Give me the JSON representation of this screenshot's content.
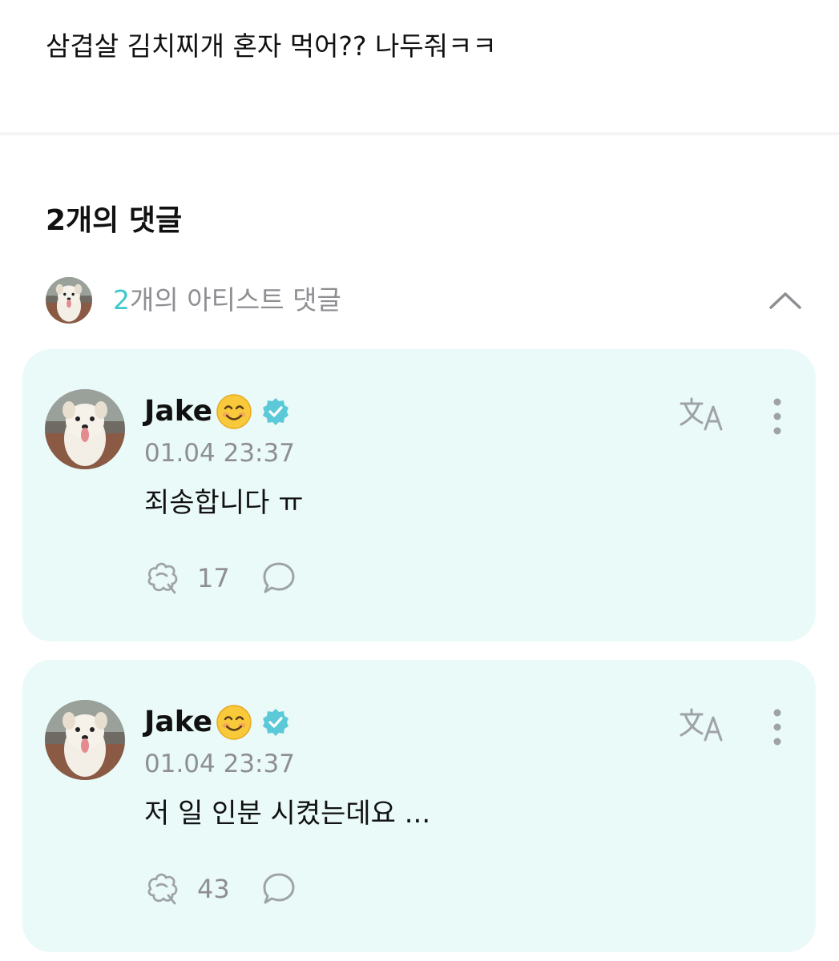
{
  "post": {
    "text": "삼겹살 김치찌개 혼자 먹어?? 나두줘ㅋㅋ"
  },
  "comments_section": {
    "title": "2개의 댓글",
    "artist_toggle": {
      "count": "2",
      "label": "개의 아티스트 댓글",
      "expanded": true
    }
  },
  "comments": [
    {
      "author": "Jake",
      "author_emoji": "smiling-face-icon",
      "verified": true,
      "timestamp": "01.04 23:37",
      "text": "죄송합니다 ㅠ",
      "likes": "17"
    },
    {
      "author": "Jake",
      "author_emoji": "smiling-face-icon",
      "verified": true,
      "timestamp": "01.04 23:37",
      "text": "저 일 인분 시켰는데요 ...",
      "likes": "43"
    }
  ],
  "colors": {
    "accent": "#3fc8cc",
    "card_background": "#e9faf8",
    "muted_text": "#8e8e93",
    "verified_badge": "#5cc9d8"
  },
  "icons": {
    "translate": "translate-icon",
    "more": "more-vertical-icon",
    "like": "like-icon",
    "reply": "reply-bubble-icon",
    "collapse": "chevron-up-icon"
  }
}
